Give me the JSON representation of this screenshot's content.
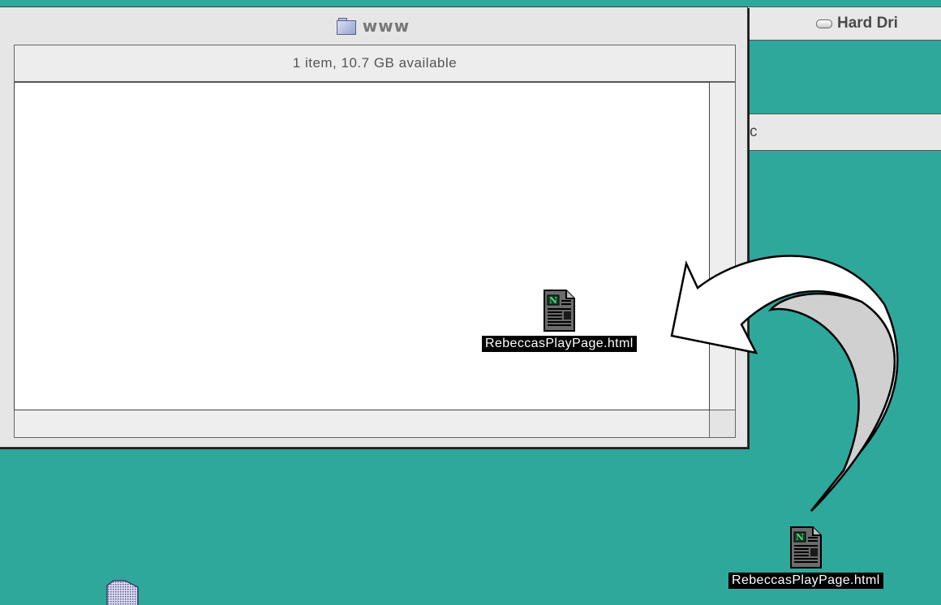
{
  "desktop": {
    "background_color": "#2fa89c"
  },
  "hard_drive_window": {
    "title": "Hard Dri",
    "icon": "hard-drive-icon"
  },
  "background_window": {
    "title": "c"
  },
  "www_window": {
    "title": "www",
    "icon": "folder-icon",
    "info": "1 item, 10.7 GB available",
    "items": [
      {
        "name": "RebeccasPlayPage.html",
        "icon": "netscape-document-icon"
      }
    ]
  },
  "desktop_items": [
    {
      "name": "RebeccasPlayPage.html",
      "icon": "netscape-document-icon"
    }
  ],
  "annotation": {
    "type": "curved-arrow",
    "meaning": "drag-from-desktop-to-window"
  }
}
